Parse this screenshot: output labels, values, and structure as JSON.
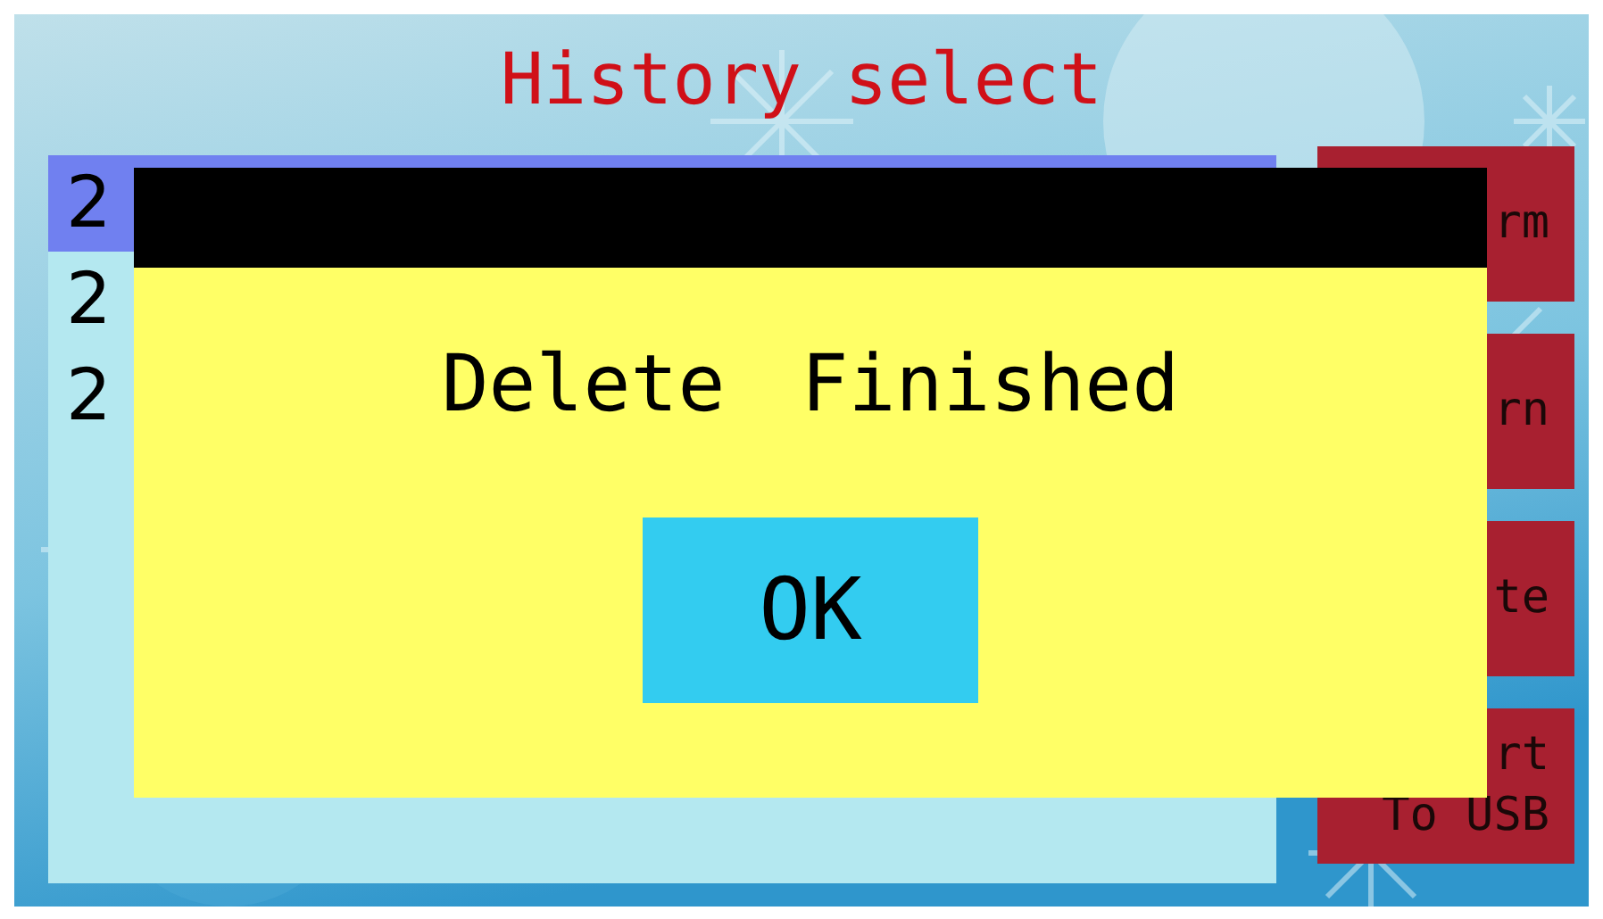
{
  "title": "History select",
  "list": {
    "rows": [
      {
        "text": "2",
        "selected": true
      },
      {
        "text": "2",
        "selected": false
      },
      {
        "text": "2",
        "selected": false
      }
    ]
  },
  "buttons": [
    {
      "lines": [
        "rm"
      ]
    },
    {
      "lines": [
        "rn"
      ]
    },
    {
      "lines": [
        "te"
      ]
    },
    {
      "lines": [
        "rt",
        "To USB"
      ]
    }
  ],
  "dialog": {
    "message": "Delete Finished",
    "ok": "OK"
  }
}
